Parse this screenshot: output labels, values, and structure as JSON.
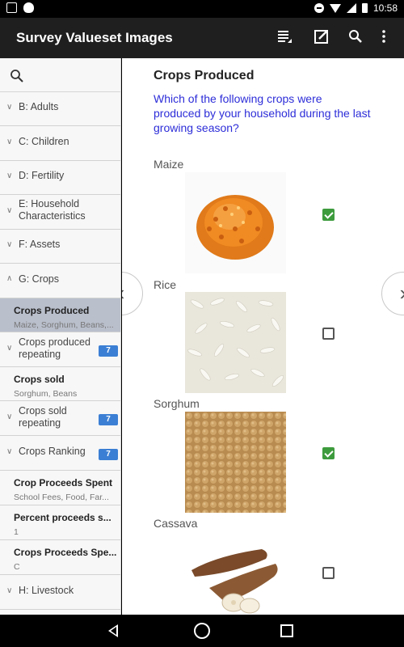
{
  "status_bar": {
    "time": "10:58"
  },
  "app_bar": {
    "title": "Survey Valueset Images",
    "actions": [
      "list-icon",
      "edit-icon",
      "search-icon",
      "overflow-menu-icon"
    ]
  },
  "sidebar": {
    "items": [
      {
        "label": "B: Adults"
      },
      {
        "label": "C: Children"
      },
      {
        "label": "D: Fertility"
      },
      {
        "label": "E: Household Characteristics"
      },
      {
        "label": "F: Assets"
      },
      {
        "label": "G: Crops"
      },
      {
        "title": "Crops Produced",
        "subtext": "Maize, Sorghum, Beans,..."
      },
      {
        "label": "Crops produced repeating",
        "badge": "7"
      },
      {
        "title": "Crops sold",
        "subtext": "Sorghum, Beans"
      },
      {
        "label": "Crops sold repeating",
        "badge": "7"
      },
      {
        "label": "Crops Ranking",
        "badge": "7"
      },
      {
        "title": "Crop Proceeds Spent",
        "subtext": "School Fees, Food, Far..."
      },
      {
        "title": "Percent proceeds s...",
        "subtext": "1"
      },
      {
        "title": "Crops Proceeds Spe...",
        "subtext": "C"
      },
      {
        "label": "H: Livestock"
      }
    ]
  },
  "main": {
    "title": "Crops Produced",
    "question": "Which of the following crops were produced by your household during the last growing season?",
    "options": [
      {
        "label": "Maize",
        "checked": true
      },
      {
        "label": "Rice",
        "checked": false
      },
      {
        "label": "Sorghum",
        "checked": true
      },
      {
        "label": "Cassava",
        "checked": false
      }
    ]
  }
}
